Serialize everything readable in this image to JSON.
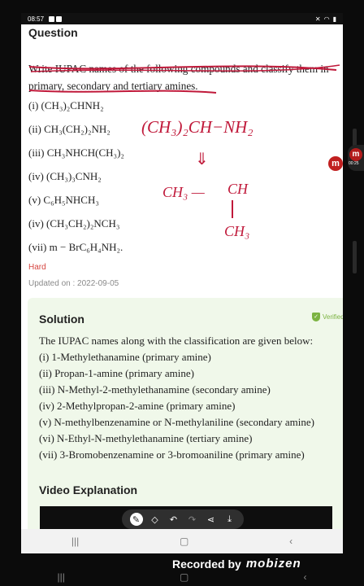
{
  "status_bar": {
    "time": "08:57"
  },
  "question": {
    "heading": "Question",
    "text_line1": "Write IUPAC names of the following compounds and classify them in",
    "text_line2": "primary, secondary and tertiary amines."
  },
  "compounds": [
    "(i) (CH₃)₂CHNH₂",
    "(ii) CH₃(CH₂)₂NH₂",
    "(iii) CH₃NHCH(CH₃)₂",
    "(iv) (CH₃)₃CNH₂",
    "(v) C₆H₅NHCH₃",
    "(iv) (CH₃CH₂)₂NCH₃",
    "(vii) m − BrC₆H₄NH₂."
  ],
  "handwriting": {
    "formula": "(CH₃)₂CH−NH₂",
    "arrow": "⇓",
    "chain_left": "CH₃ —",
    "chain_ch": "CH",
    "chain_down": "CH₃"
  },
  "difficulty": "Hard",
  "updated": "Updated on : 2022-09-05",
  "solution": {
    "heading": "Solution",
    "verified": "Verified",
    "intro": "The IUPAC names along with the classification are given below:",
    "items": [
      "(i) 1-Methylethanamine (primary amine)",
      "(ii) Propan-1-amine (primary amine)",
      "(iii) N-Methyl-2-methylethanamine (secondary amine)",
      "(iv) 2-Methylpropan-2-amine (primary amine)",
      "(v) N-methylbenzenamine or N-methylaniline (secondary amine)",
      "(vi) N-Ethyl-N-methylethanamine (tertiary amine)",
      "(vii) 3-Bromobenzenamine or 3-bromoaniline (primary amine)"
    ]
  },
  "video": {
    "heading": "Video Explanation"
  },
  "mobizen": {
    "bubble_time": "00:25",
    "recorded_by": "Recorded by",
    "brand": "mobizen"
  },
  "colors": {
    "annotation_red": "#c0193a",
    "accent_red": "#d64540",
    "solution_bg": "#f0f8ea",
    "verified_green": "#7cb342"
  }
}
